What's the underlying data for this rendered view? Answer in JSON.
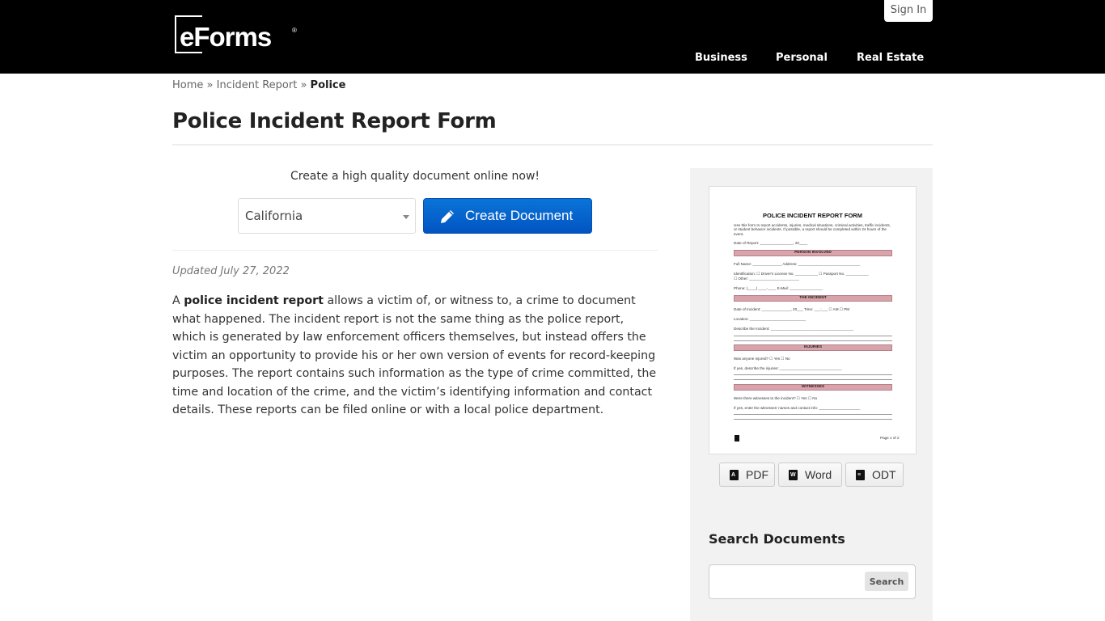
{
  "header": {
    "logo_text": "eForms",
    "logo_mark": "®",
    "sign_in_label": "Sign In",
    "nav": [
      {
        "label": "Business"
      },
      {
        "label": "Personal"
      },
      {
        "label": "Real Estate"
      }
    ]
  },
  "breadcrumb": {
    "items": [
      {
        "label": "Home"
      },
      {
        "label": "Incident Report"
      }
    ],
    "separator": "»",
    "current": "Police"
  },
  "page": {
    "title": "Police Incident Report Form",
    "tagline": "Create a high quality document online now!",
    "state_select": {
      "value": "California"
    },
    "create_button_label": "Create Document",
    "updated": "Updated July 27, 2022",
    "description": {
      "prefix": "A ",
      "bold": "police incident report",
      "rest": " allows a victim of, or witness to, a crime to document what happened. The incident report is not the same thing as the police report, which is generated by law enforcement officers themselves, but instead offers the victim an opportunity to provide his or her own version of events for record-keeping purposes. The report contains such information as the type of crime committed, the time and location of the crime, and the victim’s identifying information and contact details. These reports can be filed online or with a local police department."
    }
  },
  "sidebar": {
    "preview": {
      "title": "POLICE INCIDENT REPORT FORM",
      "intro": "Use this form to report accidents, injuries, medical situations, criminal activities, traffic incidents, or student behavior incidents. If possible, a report should be completed within 24 hours of the event.",
      "date_of_report": "Date of Report: ________________, 20____",
      "sections": [
        "PERSON INVOLVED",
        "THE INCIDENT",
        "INJURIES",
        "WITNESSES"
      ],
      "fields": {
        "full_name": "Full Name: ______________  Address: ______________________________",
        "identification": "Identification: ☐ Driver's License No. ___________  ☐ Passport No. ___________",
        "other": "☐ Other: ________________________",
        "phone": "Phone: (____) ____-____  E-Mail: ________________",
        "date_of_incident": "Date of Incident: ______________, 20___  Time: ___:___  ☐ AM ☐ PM",
        "location": "Location: ___________________________",
        "describe": "Describe the Incident: ________________________________________",
        "injured": "Was anyone injured? ☐ Yes ☐ No",
        "describe_injuries": "If yes, describe the injuries: ______________________________",
        "witnesses": "Were there witnesses to the incident? ☐ Yes ☐ No",
        "witness_info": "If yes, enter the witnesses' names and contact info: ____________________"
      },
      "page_label": "Page 1 of 2"
    },
    "formats": [
      {
        "label": "PDF",
        "icon": "pdf-icon",
        "glyph": "A"
      },
      {
        "label": "Word",
        "icon": "word-icon",
        "glyph": "W"
      },
      {
        "label": "ODT",
        "icon": "odt-icon",
        "glyph": "≡"
      }
    ],
    "search": {
      "heading": "Search Documents",
      "placeholder": "",
      "value": "",
      "button_label": "Search"
    }
  },
  "colors": {
    "header_bg": "#000000",
    "primary_button": "#0a74d8",
    "sidebar_bg": "#f2f2f2",
    "preview_band": "#d8a4ab"
  }
}
